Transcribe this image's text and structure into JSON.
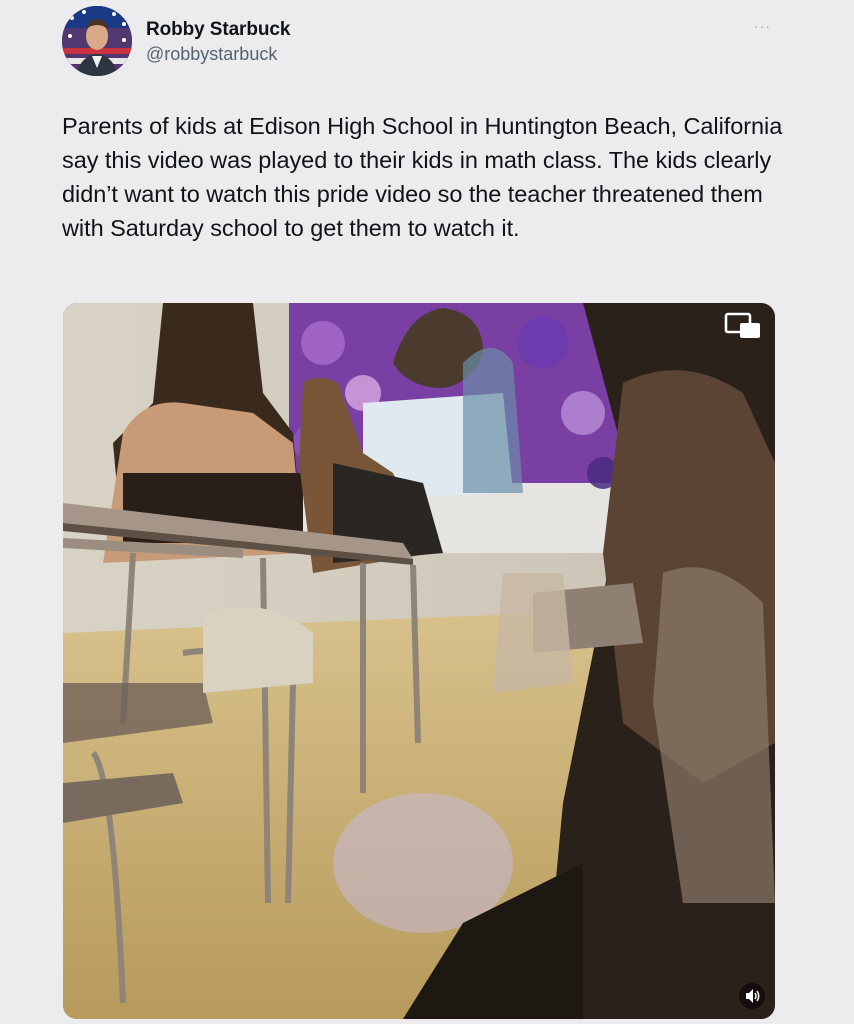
{
  "author": {
    "display_name": "Robby Starbuck",
    "handle": "@robbystarbuck",
    "avatar_icon": "profile-photo-icon"
  },
  "menu": {
    "icon": "more-options-icon",
    "label": "···"
  },
  "tweet": {
    "text": "Parents of kids at Edison High School in Huntington Beach, California say this video was played to their kids in math class. The kids clearly didn’t want to watch this pride video so the teacher threatened them with Saturday school to get them to watch it."
  },
  "media": {
    "type": "video",
    "description_icon": "video-thumbnail",
    "controls": {
      "pip_icon": "picture-in-picture-icon",
      "volume_icon": "volume-icon"
    }
  },
  "colors": {
    "background": "#ececee",
    "text": "#0f1419",
    "secondary_text": "#536471"
  }
}
